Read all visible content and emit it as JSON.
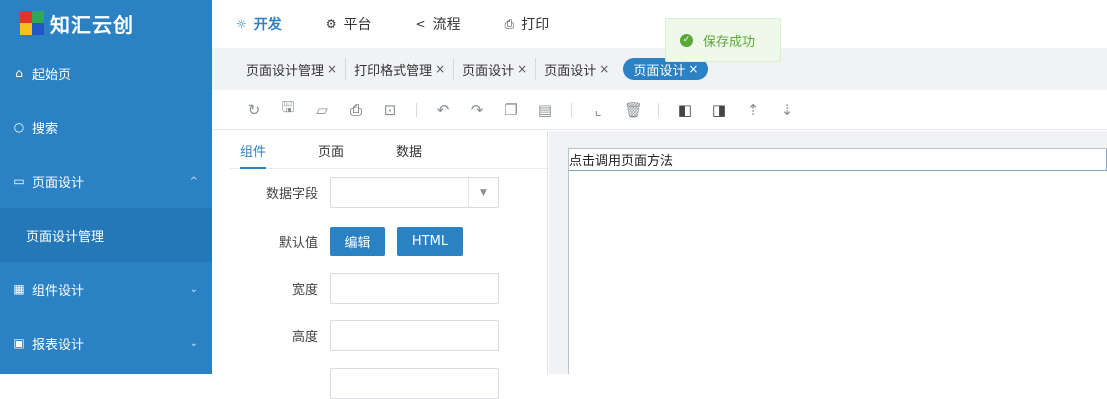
{
  "app": {
    "logo_text": "知汇云创"
  },
  "sidebar": {
    "items": [
      {
        "icon": "home-icon",
        "glyph": "⌂",
        "label": "起始页"
      },
      {
        "icon": "search-icon",
        "glyph": "○",
        "label": "搜索"
      },
      {
        "icon": "page-design-icon",
        "glyph": "▭",
        "label": "页面设计",
        "chevron": "^"
      },
      {
        "label": "页面设计管理"
      },
      {
        "icon": "grid-icon",
        "glyph": "▦",
        "label": "组件设计",
        "chevron": "⌄"
      },
      {
        "icon": "report-icon",
        "glyph": "▣",
        "label": "报表设计",
        "chevron": "⌄"
      }
    ]
  },
  "topnav": {
    "items": [
      {
        "icon": "develop-icon",
        "glyph": "☼",
        "label": "开发"
      },
      {
        "icon": "gear-icon",
        "glyph": "⚙",
        "label": "平台"
      },
      {
        "icon": "share-icon",
        "glyph": "<",
        "label": "流程"
      },
      {
        "icon": "print-icon",
        "glyph": "⎙",
        "label": "打印"
      }
    ]
  },
  "toast": {
    "text": "保存成功",
    "color": "#5aa83a"
  },
  "tabs": [
    {
      "label": "页面设计管理",
      "close": "×"
    },
    {
      "label": "打印格式管理",
      "close": "×"
    },
    {
      "label": "页面设计",
      "close": "×"
    },
    {
      "label": "页面设计",
      "close": "×"
    },
    {
      "label": "页面设计",
      "close": "×"
    }
  ],
  "toolbar": {
    "icons": [
      "refresh-icon",
      "save-icon",
      "open-folder-icon",
      "print-icon",
      "preview-icon",
      "undo-icon",
      "redo-icon",
      "copy-icon",
      "paste-icon",
      "add-area-icon",
      "delete-icon",
      "bring-forward-icon",
      "send-backward-icon",
      "sort-asc-icon",
      "sort-desc-icon"
    ]
  },
  "panel": {
    "tabs": [
      "组件",
      "页面",
      "数据"
    ],
    "fields": {
      "data_field_label": "数据字段",
      "default_label": "默认值",
      "edit_btn": "编辑",
      "html_btn": "HTML",
      "width_label": "宽度",
      "height_label": "高度"
    }
  },
  "canvas": {
    "element_text": "点击调用页面方法"
  },
  "colors": {
    "brand": "#2a81c4",
    "success": "#5aa83a"
  }
}
